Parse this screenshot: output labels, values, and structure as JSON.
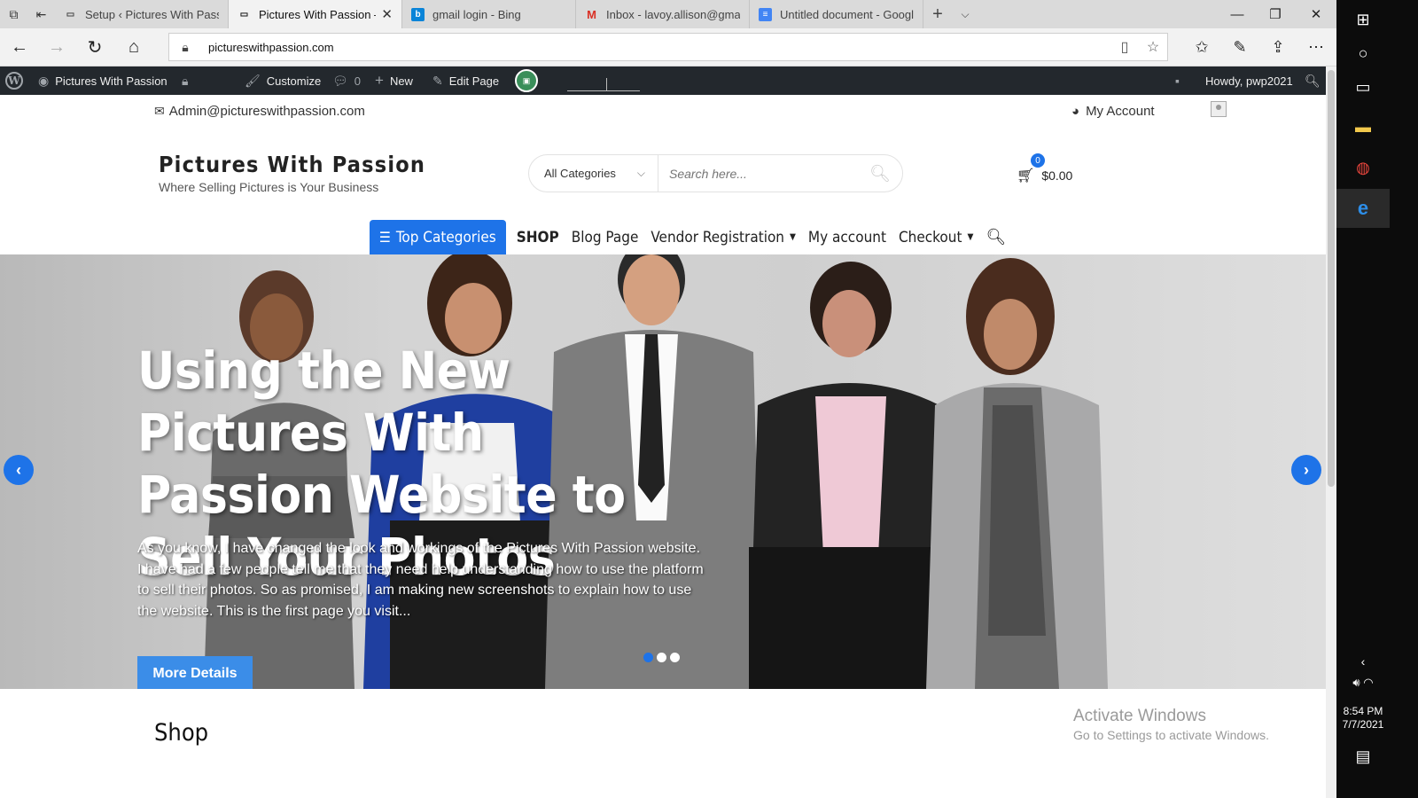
{
  "browser": {
    "tabs": [
      {
        "title": "Setup ‹ Pictures With Passio",
        "active": false,
        "favicon": "page-icon"
      },
      {
        "title": "Pictures With Passion –",
        "active": true,
        "favicon": "page-icon"
      },
      {
        "title": "gmail login - Bing",
        "active": false,
        "favicon": "bing-icon"
      },
      {
        "title": "Inbox - lavoy.allison@gmail.",
        "active": false,
        "favicon": "gmail-icon"
      },
      {
        "title": "Untitled document - Google",
        "active": false,
        "favicon": "docs-icon"
      }
    ],
    "address": "pictureswithpassion.com"
  },
  "wpbar": {
    "site_name": "Pictures With Passion",
    "customize": "Customize",
    "comments_count": "0",
    "new": "New",
    "edit_page": "Edit Page",
    "howdy": "Howdy, pwp2021"
  },
  "header": {
    "email": "Admin@pictureswithpassion.com",
    "my_account": "My Account",
    "site_title": "Pictures With Passion",
    "tagline": "Where Selling Pictures is Your Business",
    "category_select": "All Categories",
    "search_placeholder": "Search here...",
    "cart_count": "0",
    "cart_total": "$0.00"
  },
  "nav": {
    "top_categories": "Top Categories",
    "items": [
      "SHOP",
      "Blog Page",
      "Vendor Registration",
      "My account",
      "Checkout"
    ]
  },
  "hero": {
    "title": "Using the New Pictures With Passion Website to Sell Your Photos",
    "text": "As you know, I have changed the look and workings of the Pictures With Passion website. I have had a few people tell me that they need help understanding how to use the platform to sell their photos. So as promised, I am making new screenshots to explain how to use the website. This is the first page you visit...",
    "button": "More Details",
    "active_slide": 1,
    "slide_count": 3
  },
  "section": {
    "shop_heading": "Shop"
  },
  "watermark": {
    "line1": "Activate Windows",
    "line2": "Go to Settings to activate Windows."
  },
  "taskbar": {
    "time": "8:54 PM",
    "date": "7/7/2021"
  },
  "colors": {
    "accent": "#1e73e8",
    "wpbar": "#23282d"
  }
}
